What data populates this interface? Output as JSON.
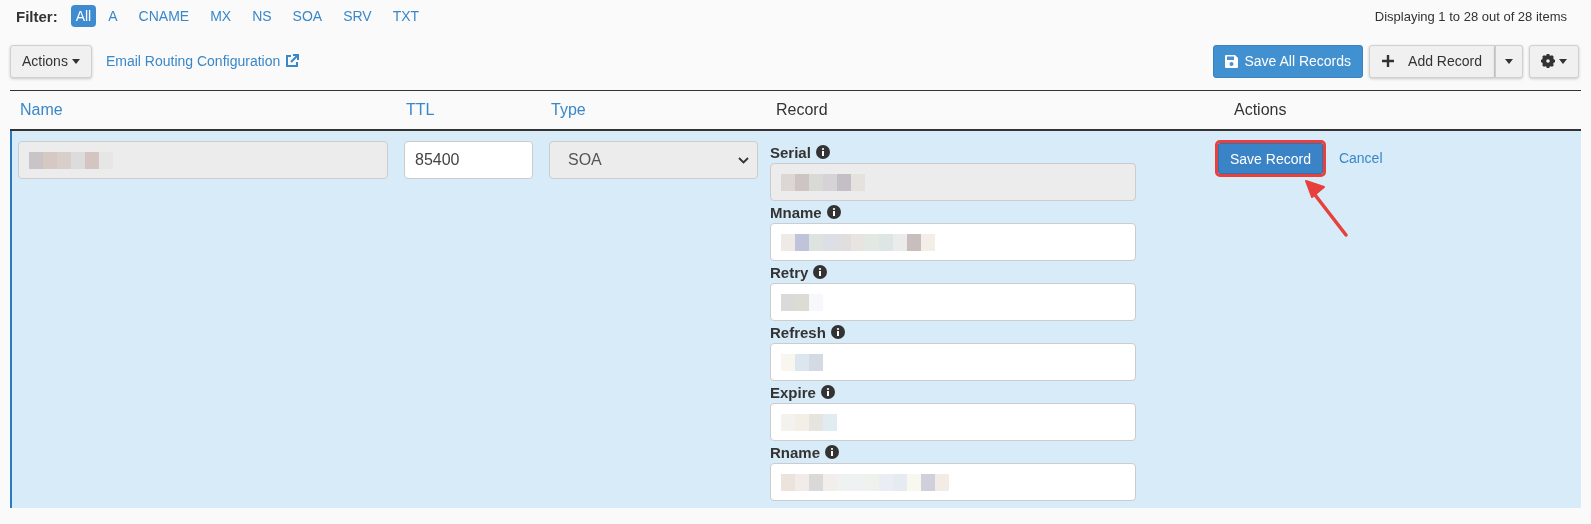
{
  "filter": {
    "label": "Filter:",
    "options": [
      {
        "label": "All",
        "selected": true
      },
      {
        "label": "A",
        "selected": false
      },
      {
        "label": "CNAME",
        "selected": false
      },
      {
        "label": "MX",
        "selected": false
      },
      {
        "label": "NS",
        "selected": false
      },
      {
        "label": "SOA",
        "selected": false
      },
      {
        "label": "SRV",
        "selected": false
      },
      {
        "label": "TXT",
        "selected": false
      }
    ]
  },
  "pagination_info": "Displaying 1 to 28 out of 28 items",
  "toolbar": {
    "actions_button": "Actions",
    "email_routing_link": "Email Routing Configuration",
    "save_all_button": "Save All Records",
    "add_record_button": "Add Record"
  },
  "table": {
    "columns": [
      {
        "label": "Name",
        "sortable": true
      },
      {
        "label": "TTL",
        "sortable": true
      },
      {
        "label": "Type",
        "sortable": true
      },
      {
        "label": "Record",
        "sortable": false
      },
      {
        "label": "Actions",
        "sortable": false
      }
    ],
    "editing_row": {
      "name": {
        "disabled": true
      },
      "ttl": "85400",
      "type": "SOA",
      "record_fields": [
        {
          "label": "Serial",
          "disabled": true
        },
        {
          "label": "Mname",
          "disabled": false
        },
        {
          "label": "Retry",
          "disabled": false
        },
        {
          "label": "Refresh",
          "disabled": false
        },
        {
          "label": "Expire",
          "disabled": false
        },
        {
          "label": "Rname",
          "disabled": false
        }
      ],
      "save_button": {
        "label": "Save Record",
        "highlighted": true
      },
      "cancel_link": "Cancel"
    }
  }
}
